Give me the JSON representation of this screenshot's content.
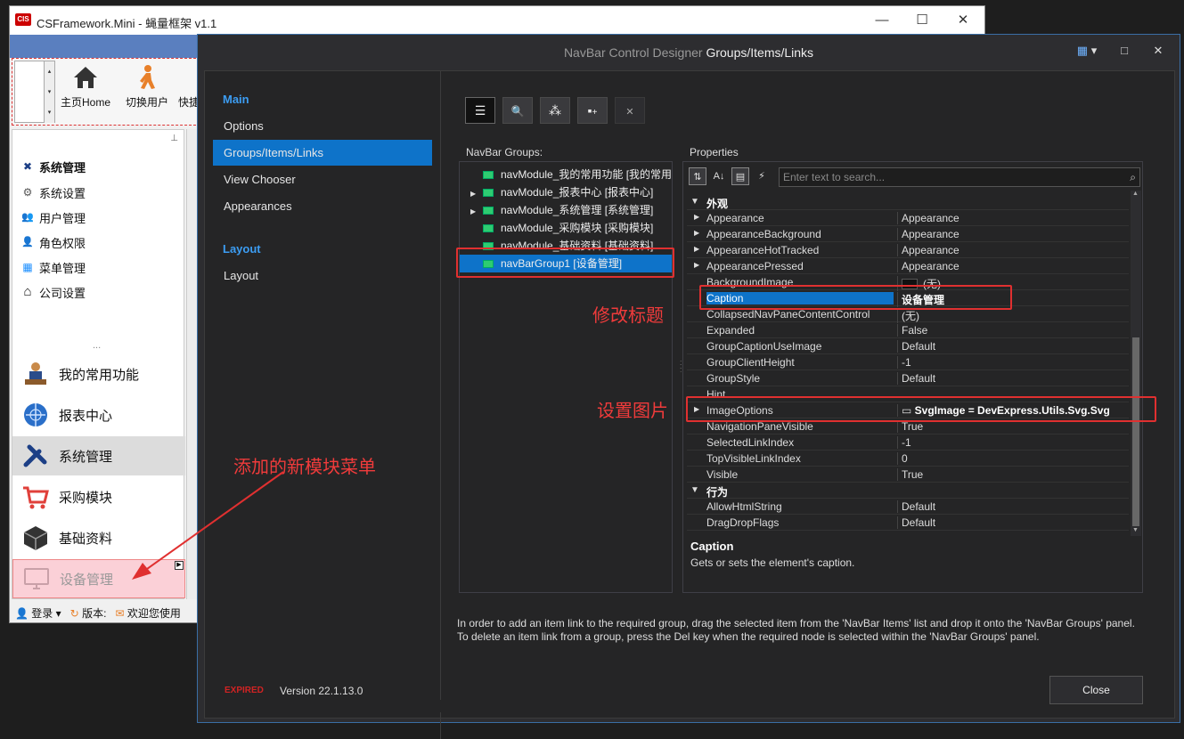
{
  "app": {
    "title": "CSFramework.Mini - 蝇量框架 v1.1",
    "logo": "CIS",
    "window_controls": {
      "minimize": "—",
      "maximize": "☐",
      "close": "✕"
    },
    "ribbon": [
      {
        "label": "主页Home",
        "icon": "home-icon"
      },
      {
        "label": "切换用户",
        "icon": "walking-user-icon"
      },
      {
        "label": "快捷",
        "icon": "shortcut-icon"
      }
    ],
    "nav_items": [
      {
        "label": "系统管理",
        "icon": "tools-icon",
        "glyph": "✖"
      },
      {
        "label": "系统设置",
        "icon": "gear-icon",
        "glyph": "⚙"
      },
      {
        "label": "用户管理",
        "icon": "users-icon",
        "glyph": "👥"
      },
      {
        "label": "角色权限",
        "icon": "user-key-icon",
        "glyph": "👤"
      },
      {
        "label": "菜单管理",
        "icon": "windows-icon",
        "glyph": "▦"
      },
      {
        "label": "公司设置",
        "icon": "house-icon",
        "glyph": "⌂"
      }
    ],
    "nav_more": "...",
    "nav_pin": "⊥",
    "groups": [
      {
        "label": "我的常用功能",
        "icon": "person-desk-icon"
      },
      {
        "label": "报表中心",
        "icon": "globe-icon"
      },
      {
        "label": "系统管理",
        "icon": "tools-icon"
      },
      {
        "label": "采购模块",
        "icon": "cart-icon"
      },
      {
        "label": "基础资料",
        "icon": "cube-icon"
      },
      {
        "label": "设备管理",
        "icon": "monitor-icon"
      }
    ],
    "status": {
      "login": "登录",
      "version": "版本:",
      "welcome": "欢迎您使用"
    }
  },
  "dialog": {
    "title_prefix": "NavBar Control Designer ",
    "title_main": "Groups/Items/Links",
    "title_buttons": {
      "layout": "▦",
      "maximize": "□",
      "close": "✕"
    },
    "sections": [
      {
        "header": "Main",
        "items": [
          "Options",
          "Groups/Items/Links",
          "View Chooser",
          "Appearances"
        ]
      },
      {
        "header": "Layout",
        "items": [
          "Layout"
        ]
      }
    ],
    "selected_item": "Groups/Items/Links",
    "expired": "EXPIRED",
    "version": "Version 22.1.13.0",
    "toolbar": [
      {
        "name": "list-icon",
        "glyph": "☰"
      },
      {
        "name": "search-icon",
        "glyph": "🔍"
      },
      {
        "name": "add-group-icon",
        "glyph": "⁂"
      },
      {
        "name": "add-item-icon",
        "glyph": "▪"
      },
      {
        "name": "delete-icon",
        "glyph": "✕"
      }
    ],
    "groups_label": "NavBar Groups:",
    "groups": [
      {
        "label": "navModule_我的常用功能 [我的常用",
        "expandable": false
      },
      {
        "label": "navModule_报表中心 [报表中心]",
        "expandable": true
      },
      {
        "label": "navModule_系统管理 [系统管理]",
        "expandable": true
      },
      {
        "label": "navModule_采购模块 [采购模块]",
        "expandable": false
      },
      {
        "label": "navModule_基础资料 [基础资料]",
        "expandable": false
      },
      {
        "label": "navBarGroup1 [设备管理]",
        "expandable": false
      }
    ],
    "properties_label": "Properties",
    "search_placeholder": "Enter text to search...",
    "property_rows": [
      {
        "name": "外观",
        "value": "",
        "category": true
      },
      {
        "name": "Appearance",
        "value": "Appearance",
        "expandable": true
      },
      {
        "name": "AppearanceBackground",
        "value": "Appearance",
        "expandable": true
      },
      {
        "name": "AppearanceHotTracked",
        "value": "Appearance",
        "expandable": true
      },
      {
        "name": "AppearancePressed",
        "value": "Appearance",
        "expandable": true
      },
      {
        "name": "BackgroundImage",
        "value": "(无)"
      },
      {
        "name": "Caption",
        "value": "设备管理",
        "selected": true,
        "bold": true
      },
      {
        "name": "CollapsedNavPaneContentControl",
        "value": "(无)"
      },
      {
        "name": "Expanded",
        "value": "False"
      },
      {
        "name": "GroupCaptionUseImage",
        "value": "Default"
      },
      {
        "name": "GroupClientHeight",
        "value": "-1"
      },
      {
        "name": "GroupStyle",
        "value": "Default"
      },
      {
        "name": "Hint",
        "value": ""
      },
      {
        "name": "ImageOptions",
        "value": "SvgImage = DevExpress.Utils.Svg.Svg",
        "expandable": true,
        "bold": true
      },
      {
        "name": "NavigationPaneVisible",
        "value": "True"
      },
      {
        "name": "SelectedLinkIndex",
        "value": "-1"
      },
      {
        "name": "TopVisibleLinkIndex",
        "value": "0"
      },
      {
        "name": "Visible",
        "value": "True"
      },
      {
        "name": "行为",
        "value": "",
        "category": true
      },
      {
        "name": "AllowHtmlString",
        "value": "Default"
      },
      {
        "name": "DragDropFlags",
        "value": "Default"
      }
    ],
    "desc_title": "Caption",
    "desc_text": "Gets or sets the element's caption.",
    "hint": "In order to add an item link to the required group, drag the selected item from the 'NavBar Items' list and drop it onto the 'NavBar Groups' panel. To delete an item link from a group, press the Del key when the required node is selected within the 'NavBar Groups' panel.",
    "close_label": "Close"
  },
  "annotations": {
    "modify_title": "修改标题",
    "set_image": "设置图片",
    "new_module": "添加的新模块菜单"
  },
  "colors": {
    "accent": "#0e73c9",
    "annotation": "#e03030"
  }
}
